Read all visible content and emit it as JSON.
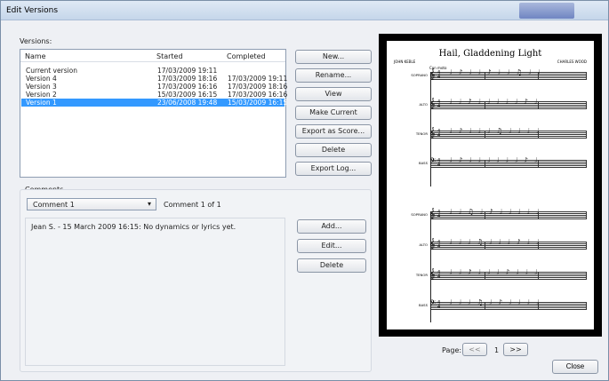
{
  "window": {
    "title": "Edit Versions"
  },
  "versions": {
    "label": "Versions:",
    "columns": [
      "Name",
      "Started",
      "Completed"
    ],
    "rows": [
      {
        "name": "Current version",
        "started": "17/03/2009 19:11",
        "completed": ""
      },
      {
        "name": "Version 4",
        "started": "17/03/2009 18:16",
        "completed": "17/03/2009 19:11"
      },
      {
        "name": "Version 3",
        "started": "17/03/2009 16:16",
        "completed": "17/03/2009 18:16"
      },
      {
        "name": "Version 2",
        "started": "15/03/2009 16:15",
        "completed": "17/03/2009 16:16"
      },
      {
        "name": "Version 1",
        "started": "23/06/2008 19:48",
        "completed": "15/03/2009 16:15"
      }
    ],
    "selected_index": 4
  },
  "version_buttons": {
    "new": "New...",
    "rename": "Rename...",
    "view": "View",
    "make_current": "Make Current",
    "export_score": "Export as Score...",
    "delete": "Delete",
    "export_log": "Export Log..."
  },
  "comments": {
    "label": "Comments",
    "selected": "Comment 1",
    "counter": "Comment 1 of 1",
    "text": "Jean S. - 15 March 2009 16:15: No dynamics or lyrics yet.",
    "buttons": {
      "add": "Add...",
      "edit": "Edit...",
      "delete": "Delete"
    }
  },
  "preview": {
    "score_title": "Hail, Gladdening Light",
    "lyricist": "JOHN KEBLE",
    "composer": "CHARLES WOOD",
    "tempo": "Con moto",
    "staves": [
      "SOPRANO",
      "ALTO",
      "TENOR",
      "BASS",
      "SOPRANO",
      "ALTO",
      "TENOR",
      "BASS"
    ]
  },
  "pager": {
    "label": "Page:",
    "prev": "<<",
    "page": "1",
    "next": ">>"
  },
  "close_label": "Close",
  "colors": {
    "selection": "#3399ff",
    "preview_bg": "#000000"
  }
}
